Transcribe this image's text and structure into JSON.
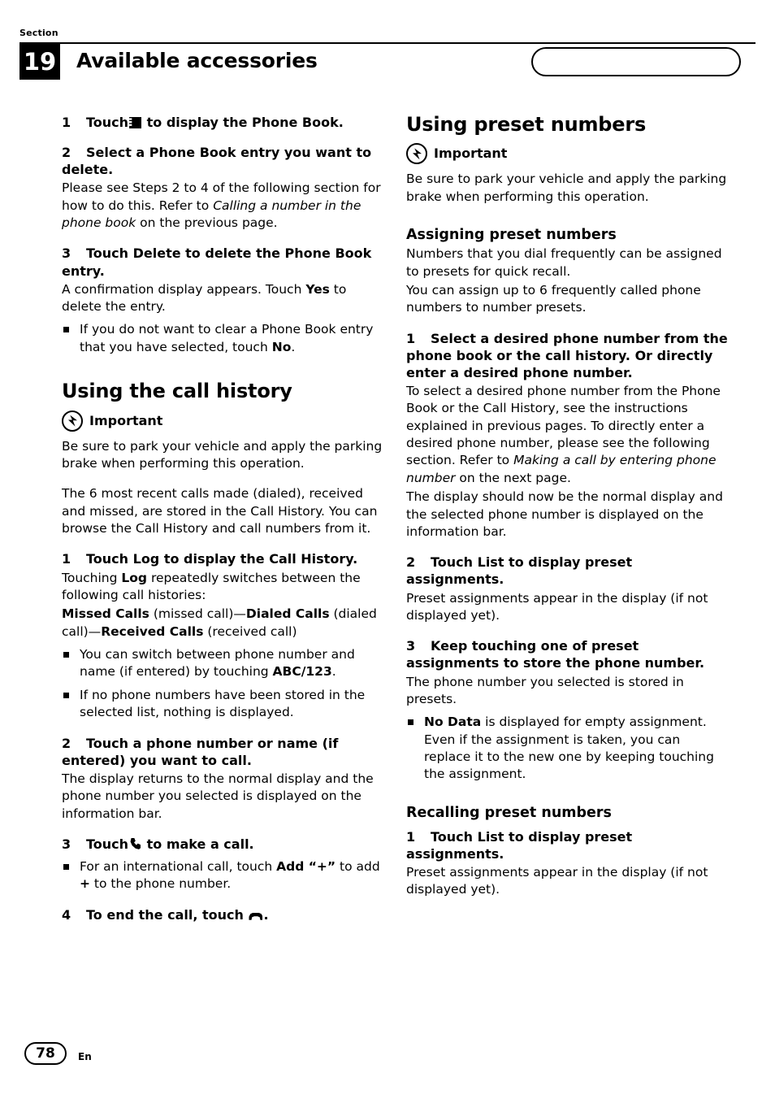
{
  "header": {
    "section_label": "Section",
    "section_number": "19",
    "chapter_title": "Available accessories"
  },
  "footer": {
    "page_number": "78",
    "language": "En"
  },
  "left_column": {
    "step1": "1 Touch   to display the Phone Book.",
    "step1_num": "1",
    "step1_text_a": "Touch",
    "step1_text_b": "to display the Phone Book.",
    "step2_num": "2",
    "step2_text": "Select a Phone Book entry you want to delete.",
    "step2_body_a": "Please see Steps 2 to 4 of the following section for how to do this. Refer to ",
    "step2_body_italic": "Calling a number in the phone book",
    "step2_body_b": " on the previous page.",
    "step3_num": "3",
    "step3_text": "Touch Delete to delete the Phone Book entry.",
    "step3_body_a": "A confirmation display appears. Touch ",
    "step3_body_bold": "Yes",
    "step3_body_b": " to delete the entry.",
    "step3_bullet_a": "If you do not want to clear a Phone Book entry that you have selected, touch ",
    "step3_bullet_bold": "No",
    "step3_bullet_b": ".",
    "heading_call_history": "Using the call history",
    "important_label": "Important",
    "important_body": "Be sure to park your vehicle and apply the parking brake when performing this operation.",
    "intro_body": "The 6 most recent calls made (dialed), received and missed, are stored in the Call History. You can browse the Call History and call numbers from it.",
    "ch_step1_num": "1",
    "ch_step1_text": "Touch Log to display the Call History.",
    "ch_step1_body_a": "Touching ",
    "ch_step1_body_bold": "Log",
    "ch_step1_body_b": " repeatedly switches between the following call histories:",
    "ch_list_bold1": "Missed Calls",
    "ch_list_mid1": " (missed call)—",
    "ch_list_bold2": "Dialed Calls",
    "ch_list_mid2": " (dialed call)—",
    "ch_list_bold3": "Received Calls",
    "ch_list_mid3": " (received call)",
    "ch_bullet1_a": "You can switch between phone number and name (if entered) by touching ",
    "ch_bullet1_bold": "ABC/123",
    "ch_bullet1_b": ".",
    "ch_bullet2": "If no phone numbers have been stored in the selected list, nothing is displayed.",
    "ch_step2_num": "2",
    "ch_step2_text": "Touch a phone number or name (if entered) you want to call.",
    "ch_step2_body": "The display returns to the normal display and the phone number you selected is displayed on the information bar.",
    "ch_step3_num": "3",
    "ch_step3_text_a": "Touch",
    "ch_step3_text_b": "to make a call.",
    "ch_step3_bullet_a": "For an international call, touch ",
    "ch_step3_bullet_bold": "Add “+”",
    "ch_step3_bullet_b": " to add ",
    "ch_step3_bullet_bold2": "+",
    "ch_step3_bullet_c": " to the phone number.",
    "ch_step4_num": "4",
    "ch_step4_text_a": "To end the call, touch",
    "ch_step4_text_b": "."
  },
  "right_column": {
    "heading_preset": "Using preset numbers",
    "important_label": "Important",
    "important_body": "Be sure to park your vehicle and apply the parking brake when performing this operation.",
    "sub_assigning": "Assigning preset numbers",
    "assign_body1": "Numbers that you dial frequently can be assigned to presets for quick recall.",
    "assign_body2": "You can assign up to 6 frequently called phone numbers to number presets.",
    "as_step1_num": "1",
    "as_step1_text": "Select a desired phone number from the phone book or the call history. Or directly enter a desired phone number.",
    "as_step1_body_a": "To select a desired phone number from the Phone Book or the Call History, see the instructions explained in previous pages. To directly enter a desired phone number, please see the following section. Refer to ",
    "as_step1_body_italic": "Making a call by entering phone number",
    "as_step1_body_b": " on the next page.",
    "as_step1_body2": "The display should now be the normal display and the selected phone number is displayed on the information bar.",
    "as_step2_num": "2",
    "as_step2_text": "Touch List to display preset assignments.",
    "as_step2_body": "Preset assignments appear in the display (if not displayed yet).",
    "as_step3_num": "3",
    "as_step3_text": "Keep touching one of preset assignments to store the phone number.",
    "as_step3_body": "The phone number you selected is stored in presets.",
    "as_bullet_bold": "No Data",
    "as_bullet_a": " is displayed for empty assignment. Even if the assignment is taken, you can replace it to the new one by keeping touching the assignment.",
    "sub_recalling": "Recalling preset numbers",
    "rc_step1_num": "1",
    "rc_step1_text": "Touch List to display preset assignments.",
    "rc_step1_body": "Preset assignments appear in the display (if not displayed yet)."
  }
}
